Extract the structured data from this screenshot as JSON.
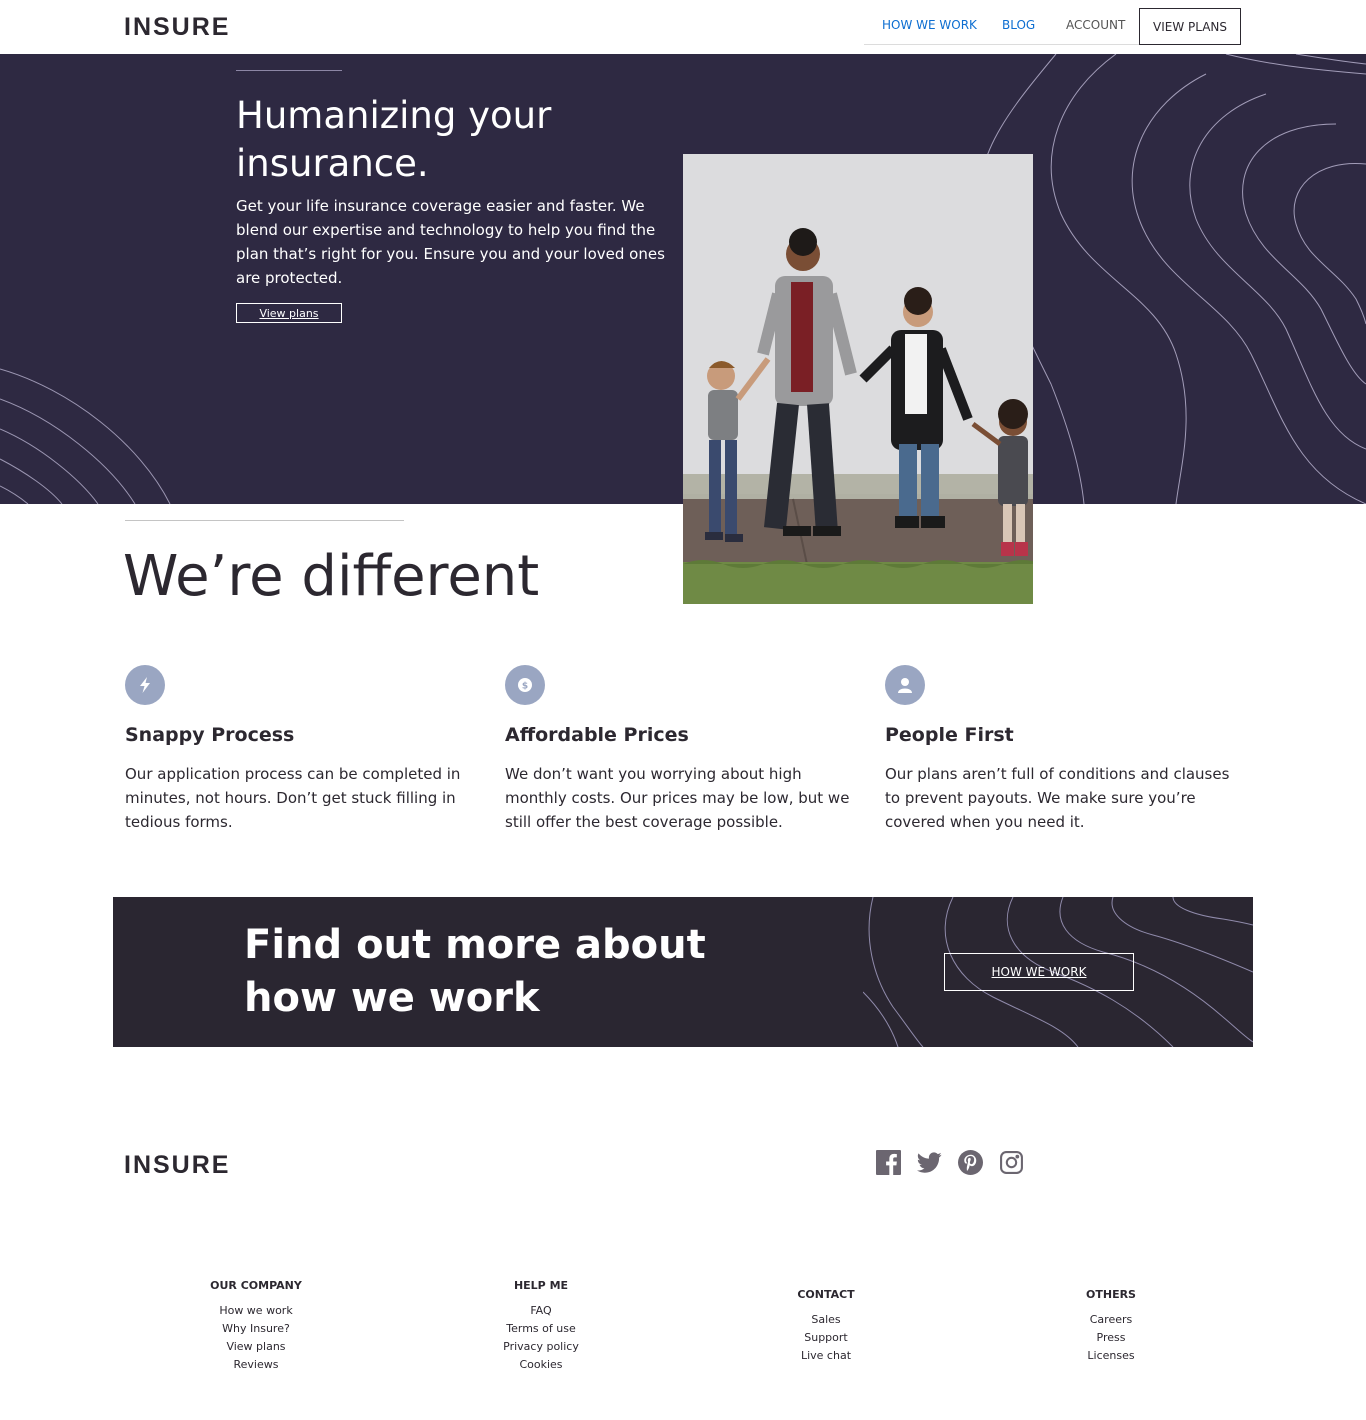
{
  "header": {
    "logo": "INSURE",
    "nav": [
      "HOW WE WORK",
      "BLOG",
      "ACCOUNT",
      "VIEW PLANS"
    ]
  },
  "hero": {
    "title": "Humanizing your insurance.",
    "text": "Get your life insurance coverage easier and faster. We blend our expertise and technology to help you find the plan that’s right for you. Ensure you and your loved ones are protected.",
    "button": "View plans"
  },
  "different": {
    "title": "We’re different",
    "features": [
      {
        "icon": "lightning-icon",
        "title": "Snappy Process",
        "text": "Our application process can be completed in minutes, not hours. Don’t get stuck filling in tedious forms."
      },
      {
        "icon": "dollar-icon",
        "title": "Affordable Prices",
        "text": "We don’t want you worrying about high monthly costs. Our prices may be low, but we still offer the best coverage possible."
      },
      {
        "icon": "person-icon",
        "title": "People First",
        "text": "Our plans aren’t full of conditions and clauses to prevent payouts. We make sure you’re covered when you need it."
      }
    ]
  },
  "cta": {
    "title": "Find out more about how we work",
    "button": "HOW WE WORK"
  },
  "footer": {
    "logo": "INSURE",
    "social": [
      "facebook-icon",
      "twitter-icon",
      "pinterest-icon",
      "instagram-icon"
    ],
    "columns": [
      {
        "heading": "OUR COMPANY",
        "links": [
          "How we work",
          "Why Insure?",
          "View plans",
          "Reviews"
        ]
      },
      {
        "heading": "HELP ME",
        "links": [
          "FAQ",
          "Terms of use",
          "Privacy policy",
          "Cookies"
        ]
      },
      {
        "heading": "CONTACT",
        "links": [
          "Sales",
          "Support",
          "Live chat"
        ]
      },
      {
        "heading": "OTHERS",
        "links": [
          "Careers",
          "Press",
          "Licenses"
        ]
      }
    ]
  },
  "colors": {
    "hero_bg": "#2e2942",
    "cta_bg": "#2a2631",
    "nav_link": "#0d6ed1",
    "icon_circle": "#9aa6c2",
    "text_dark": "#2c2830"
  }
}
